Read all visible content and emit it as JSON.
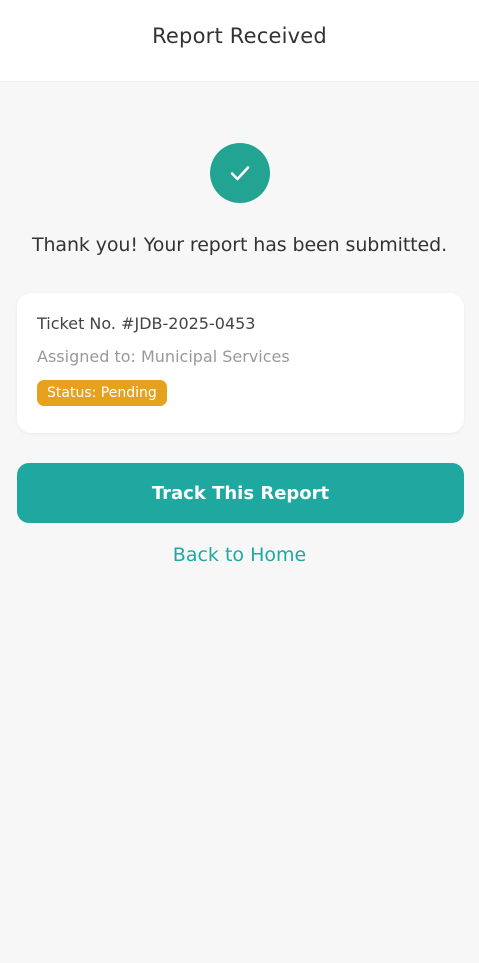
{
  "header": {
    "title": "Report Received"
  },
  "success_icon": "check-icon",
  "message": "Thank you! Your report has been submitted.",
  "ticket_card": {
    "ticket_number": "Ticket No. #JDB-2025-0453",
    "assigned_to": "Assigned to: Municipal Services",
    "status": "Status: Pending"
  },
  "actions": {
    "track_label": "Track This Report",
    "back_label": "Back to Home"
  },
  "colors": {
    "accent": "#1ea8a0",
    "icon_circle": "#23a392",
    "status_badge": "#e6a21f",
    "background": "#f7f7f7"
  }
}
